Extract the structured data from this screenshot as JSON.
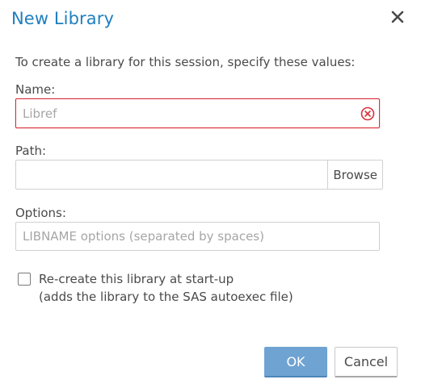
{
  "dialog": {
    "title": "New Library",
    "instructions": "To create a library for this session, specify these values:"
  },
  "name_field": {
    "label": "Name:",
    "value": "",
    "placeholder": "Libref",
    "error_color": "#d9303b"
  },
  "path_field": {
    "label": "Path:",
    "value": "",
    "placeholder": "",
    "browse_label": "Browse"
  },
  "options_field": {
    "label": "Options:",
    "value": "",
    "placeholder": "LIBNAME options (separated by spaces)"
  },
  "startup_checkbox": {
    "checked": false,
    "label_line1": "Re-create this library at start-up",
    "label_line2": "(adds the library to the SAS autoexec file)"
  },
  "buttons": {
    "ok_label": "OK",
    "cancel_label": "Cancel"
  },
  "colors": {
    "title": "#1f7fbf",
    "primary_button": "#6ea3d2",
    "error": "#d9303b"
  },
  "icons": {
    "close": "close-icon",
    "error": "error-circle-x-icon"
  }
}
